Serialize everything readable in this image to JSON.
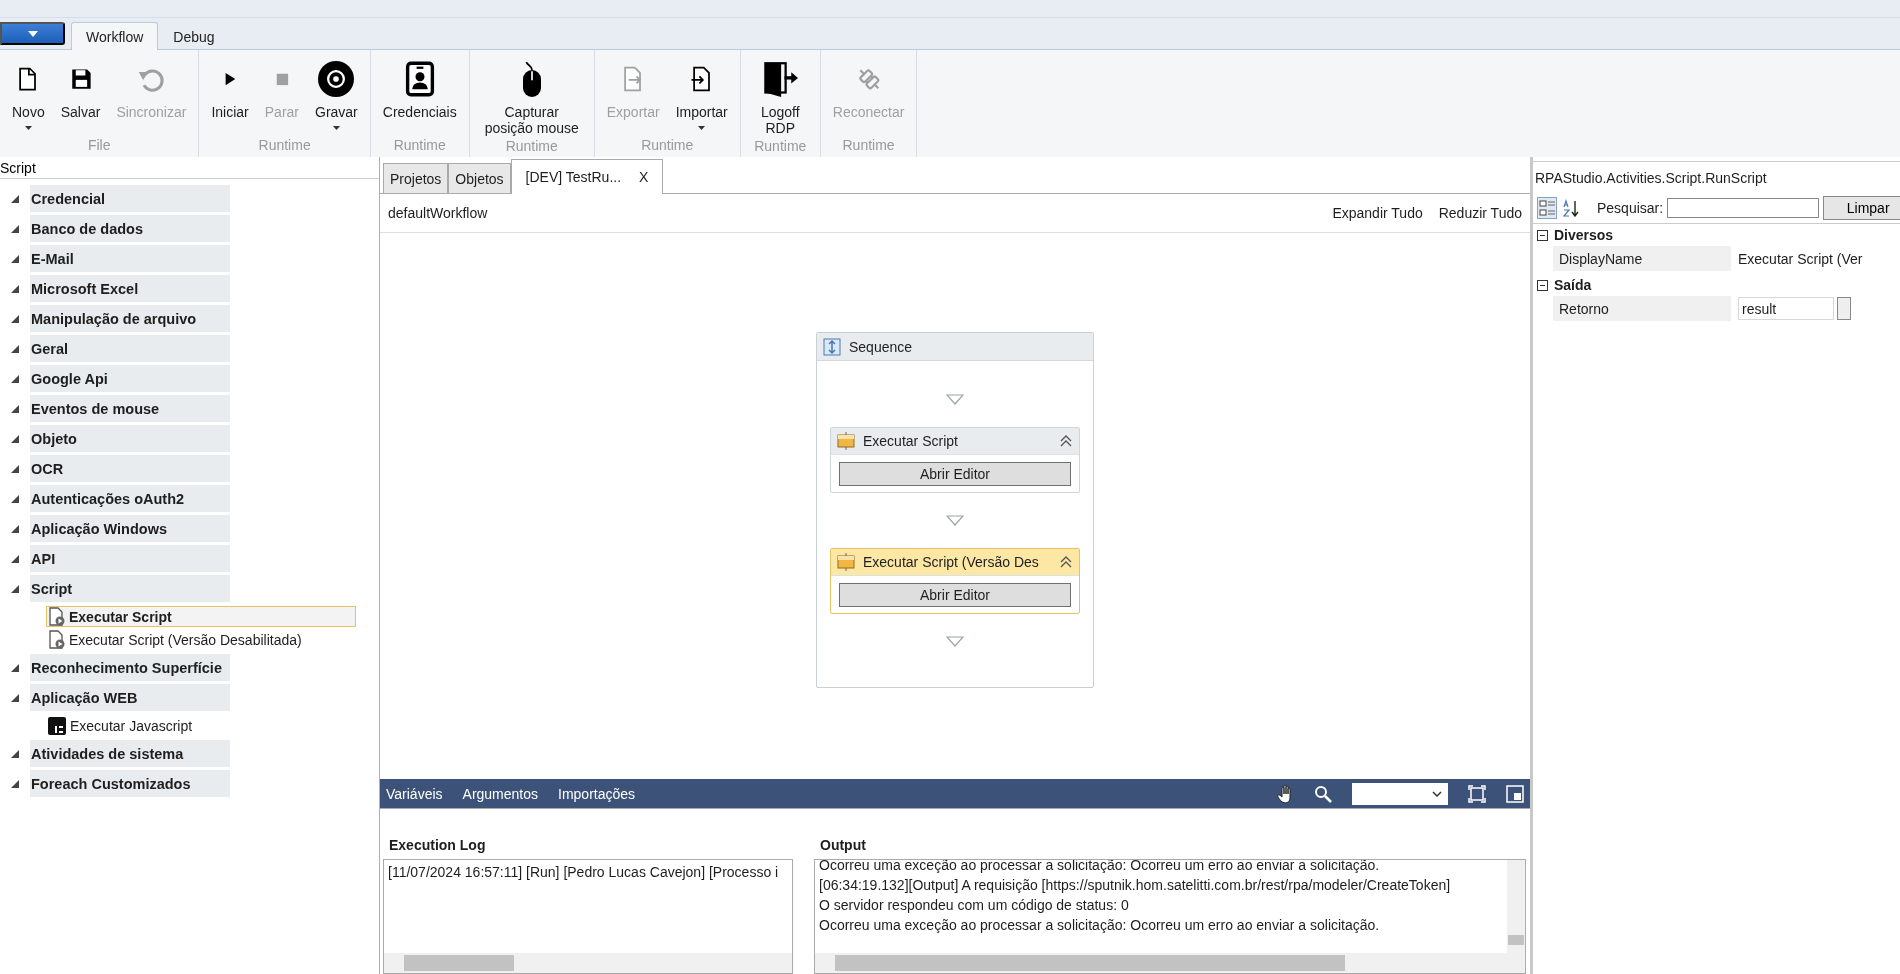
{
  "ribbon": {
    "tabs": [
      {
        "label": "Workflow",
        "selected": true
      },
      {
        "label": "Debug",
        "selected": false
      }
    ],
    "groups": [
      {
        "label": "File",
        "buttons": [
          {
            "kind": "new",
            "label": "Novo",
            "disabled": false,
            "dropdown": true
          },
          {
            "kind": "save",
            "label": "Salvar",
            "disabled": false,
            "dropdown": false
          },
          {
            "kind": "sync",
            "label": "Sincronizar",
            "disabled": true,
            "dropdown": false
          }
        ]
      },
      {
        "label": "Runtime",
        "buttons": [
          {
            "kind": "start",
            "label": "Iniciar",
            "disabled": false,
            "dropdown": false
          },
          {
            "kind": "stop",
            "label": "Parar",
            "disabled": true,
            "dropdown": false
          },
          {
            "kind": "record",
            "label": "Gravar",
            "disabled": false,
            "dropdown": true
          }
        ]
      },
      {
        "label": "Runtime",
        "buttons": [
          {
            "kind": "credentials",
            "label": "Credenciais",
            "disabled": false,
            "dropdown": false
          }
        ]
      },
      {
        "label": "Runtime",
        "buttons": [
          {
            "kind": "mouse",
            "label": "Capturar posição mouse",
            "disabled": false,
            "dropdown": false
          }
        ]
      },
      {
        "label": "Runtime",
        "buttons": [
          {
            "kind": "export",
            "label": "Exportar",
            "disabled": true,
            "dropdown": false
          },
          {
            "kind": "import",
            "label": "Importar",
            "disabled": false,
            "dropdown": true
          }
        ]
      },
      {
        "label": "Runtime",
        "buttons": [
          {
            "kind": "logoff",
            "label": "Logoff RDP",
            "disabled": false,
            "dropdown": false
          }
        ]
      },
      {
        "label": "Runtime",
        "buttons": [
          {
            "kind": "reconnect",
            "label": "Reconectar",
            "disabled": true,
            "dropdown": false
          }
        ]
      }
    ]
  },
  "toolbox": {
    "search": "Script",
    "categories": [
      {
        "label": "Credencial",
        "expanded": true
      },
      {
        "label": "Banco de dados",
        "expanded": true
      },
      {
        "label": "E-Mail",
        "expanded": true
      },
      {
        "label": "Microsoft Excel",
        "expanded": true
      },
      {
        "label": "Manipulação de arquivo",
        "expanded": true
      },
      {
        "label": "Geral",
        "expanded": true
      },
      {
        "label": "Google Api",
        "expanded": true
      },
      {
        "label": "Eventos de mouse",
        "expanded": true
      },
      {
        "label": "Objeto",
        "expanded": true
      },
      {
        "label": "OCR",
        "expanded": true
      },
      {
        "label": "Autenticações oAuth2",
        "expanded": true
      },
      {
        "label": "Aplicação Windows",
        "expanded": true
      },
      {
        "label": "API",
        "expanded": true
      },
      {
        "label": "Script",
        "expanded": true,
        "children": [
          {
            "label": "Executar Script",
            "kind": "script",
            "selected": true
          },
          {
            "label": "Executar Script (Versão Desabilitada)",
            "kind": "script",
            "selected": false
          }
        ]
      },
      {
        "label": "Reconhecimento Superfície",
        "expanded": true
      },
      {
        "label": "Aplicação WEB",
        "expanded": true,
        "children": [
          {
            "label": "Executar Javascript",
            "kind": "javascript",
            "selected": false
          }
        ]
      },
      {
        "label": "Atividades de sistema",
        "expanded": true
      },
      {
        "label": "Foreach Customizados",
        "expanded": true
      }
    ]
  },
  "documents": {
    "tabs": [
      {
        "label": "Projetos",
        "selected": false
      },
      {
        "label": "Objetos",
        "selected": false
      },
      {
        "label": "[DEV] TestRu...",
        "selected": true,
        "close": "X"
      }
    ]
  },
  "designer": {
    "breadcrumb": "defaultWorkflow",
    "expand_all": "Expandir Tudo",
    "collapse_all": "Reduzir Tudo",
    "sequence": {
      "title": "Sequence",
      "activities": [
        {
          "title": "Executar Script",
          "selected": false,
          "button": "Abrir Editor"
        },
        {
          "title": "Executar Script (Versão Des",
          "selected": true,
          "button": "Abrir Editor"
        }
      ]
    }
  },
  "bottom_bar": {
    "tabs": [
      "Variáveis",
      "Argumentos",
      "Importações"
    ]
  },
  "execution_log": {
    "title": "Execution Log",
    "lines": [
      "[11/07/2024 16:57:11] [Run] [Pedro Lucas Cavejon] [Processo i"
    ]
  },
  "output": {
    "title": "Output",
    "lines": [
      "Ocorreu uma exceção ao processar a solicitação: Ocorreu um erro ao enviar a solicitação.",
      "[06:34:19.132][Output] A requisição [https://sputnik.hom.satelitti.com.br/rest/rpa/modeler/CreateToken]",
      "O servidor respondeu com um código de status: 0",
      "Ocorreu uma exceção ao processar a solicitação: Ocorreu um erro ao enviar a solicitação."
    ]
  },
  "properties": {
    "title": "RPAStudio.Activities.Script.RunScript",
    "sort_buttons": [
      {
        "kind": "categorized",
        "selected": true
      },
      {
        "kind": "alphabetical",
        "selected": false
      }
    ],
    "search_label": "Pesquisar:",
    "clear": "Limpar",
    "categories": [
      {
        "label": "Diversos",
        "expanded": true,
        "rows": [
          {
            "name": "DisplayName",
            "value": "Executar Script (Ver",
            "kind": "text"
          }
        ]
      },
      {
        "label": "Saída",
        "expanded": true,
        "rows": [
          {
            "name": "Retorno",
            "value": "result",
            "kind": "input"
          }
        ]
      }
    ]
  }
}
